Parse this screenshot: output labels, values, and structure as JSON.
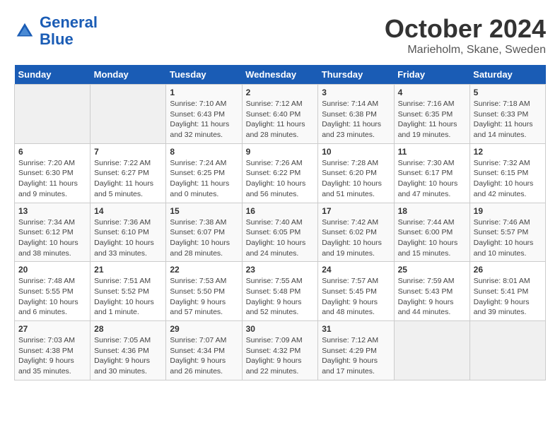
{
  "header": {
    "logo_line1": "General",
    "logo_line2": "Blue",
    "month": "October 2024",
    "location": "Marieholm, Skane, Sweden"
  },
  "weekdays": [
    "Sunday",
    "Monday",
    "Tuesday",
    "Wednesday",
    "Thursday",
    "Friday",
    "Saturday"
  ],
  "weeks": [
    [
      {
        "day": "",
        "info": ""
      },
      {
        "day": "",
        "info": ""
      },
      {
        "day": "1",
        "info": "Sunrise: 7:10 AM\nSunset: 6:43 PM\nDaylight: 11 hours and 32 minutes."
      },
      {
        "day": "2",
        "info": "Sunrise: 7:12 AM\nSunset: 6:40 PM\nDaylight: 11 hours and 28 minutes."
      },
      {
        "day": "3",
        "info": "Sunrise: 7:14 AM\nSunset: 6:38 PM\nDaylight: 11 hours and 23 minutes."
      },
      {
        "day": "4",
        "info": "Sunrise: 7:16 AM\nSunset: 6:35 PM\nDaylight: 11 hours and 19 minutes."
      },
      {
        "day": "5",
        "info": "Sunrise: 7:18 AM\nSunset: 6:33 PM\nDaylight: 11 hours and 14 minutes."
      }
    ],
    [
      {
        "day": "6",
        "info": "Sunrise: 7:20 AM\nSunset: 6:30 PM\nDaylight: 11 hours and 9 minutes."
      },
      {
        "day": "7",
        "info": "Sunrise: 7:22 AM\nSunset: 6:27 PM\nDaylight: 11 hours and 5 minutes."
      },
      {
        "day": "8",
        "info": "Sunrise: 7:24 AM\nSunset: 6:25 PM\nDaylight: 11 hours and 0 minutes."
      },
      {
        "day": "9",
        "info": "Sunrise: 7:26 AM\nSunset: 6:22 PM\nDaylight: 10 hours and 56 minutes."
      },
      {
        "day": "10",
        "info": "Sunrise: 7:28 AM\nSunset: 6:20 PM\nDaylight: 10 hours and 51 minutes."
      },
      {
        "day": "11",
        "info": "Sunrise: 7:30 AM\nSunset: 6:17 PM\nDaylight: 10 hours and 47 minutes."
      },
      {
        "day": "12",
        "info": "Sunrise: 7:32 AM\nSunset: 6:15 PM\nDaylight: 10 hours and 42 minutes."
      }
    ],
    [
      {
        "day": "13",
        "info": "Sunrise: 7:34 AM\nSunset: 6:12 PM\nDaylight: 10 hours and 38 minutes."
      },
      {
        "day": "14",
        "info": "Sunrise: 7:36 AM\nSunset: 6:10 PM\nDaylight: 10 hours and 33 minutes."
      },
      {
        "day": "15",
        "info": "Sunrise: 7:38 AM\nSunset: 6:07 PM\nDaylight: 10 hours and 28 minutes."
      },
      {
        "day": "16",
        "info": "Sunrise: 7:40 AM\nSunset: 6:05 PM\nDaylight: 10 hours and 24 minutes."
      },
      {
        "day": "17",
        "info": "Sunrise: 7:42 AM\nSunset: 6:02 PM\nDaylight: 10 hours and 19 minutes."
      },
      {
        "day": "18",
        "info": "Sunrise: 7:44 AM\nSunset: 6:00 PM\nDaylight: 10 hours and 15 minutes."
      },
      {
        "day": "19",
        "info": "Sunrise: 7:46 AM\nSunset: 5:57 PM\nDaylight: 10 hours and 10 minutes."
      }
    ],
    [
      {
        "day": "20",
        "info": "Sunrise: 7:48 AM\nSunset: 5:55 PM\nDaylight: 10 hours and 6 minutes."
      },
      {
        "day": "21",
        "info": "Sunrise: 7:51 AM\nSunset: 5:52 PM\nDaylight: 10 hours and 1 minute."
      },
      {
        "day": "22",
        "info": "Sunrise: 7:53 AM\nSunset: 5:50 PM\nDaylight: 9 hours and 57 minutes."
      },
      {
        "day": "23",
        "info": "Sunrise: 7:55 AM\nSunset: 5:48 PM\nDaylight: 9 hours and 52 minutes."
      },
      {
        "day": "24",
        "info": "Sunrise: 7:57 AM\nSunset: 5:45 PM\nDaylight: 9 hours and 48 minutes."
      },
      {
        "day": "25",
        "info": "Sunrise: 7:59 AM\nSunset: 5:43 PM\nDaylight: 9 hours and 44 minutes."
      },
      {
        "day": "26",
        "info": "Sunrise: 8:01 AM\nSunset: 5:41 PM\nDaylight: 9 hours and 39 minutes."
      }
    ],
    [
      {
        "day": "27",
        "info": "Sunrise: 7:03 AM\nSunset: 4:38 PM\nDaylight: 9 hours and 35 minutes."
      },
      {
        "day": "28",
        "info": "Sunrise: 7:05 AM\nSunset: 4:36 PM\nDaylight: 9 hours and 30 minutes."
      },
      {
        "day": "29",
        "info": "Sunrise: 7:07 AM\nSunset: 4:34 PM\nDaylight: 9 hours and 26 minutes."
      },
      {
        "day": "30",
        "info": "Sunrise: 7:09 AM\nSunset: 4:32 PM\nDaylight: 9 hours and 22 minutes."
      },
      {
        "day": "31",
        "info": "Sunrise: 7:12 AM\nSunset: 4:29 PM\nDaylight: 9 hours and 17 minutes."
      },
      {
        "day": "",
        "info": ""
      },
      {
        "day": "",
        "info": ""
      }
    ]
  ]
}
